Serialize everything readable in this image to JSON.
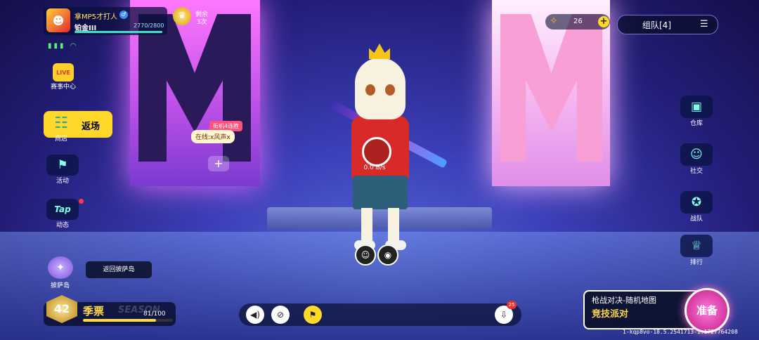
{
  "player": {
    "name": "拿MP5才打人",
    "gender_symbol": "♂",
    "rank": "铂金III",
    "xp": "2770/2800",
    "xp_fraction": 0.989,
    "remaining_label": "剩余",
    "remaining_count": "3次"
  },
  "left_menu": {
    "events": "赛事中心",
    "events_icon_text": "LIVE",
    "shop_action": "返场",
    "shop": "商店",
    "activity": "活动",
    "feed": "动态",
    "feed_icon_text": "Tap"
  },
  "chat": {
    "streak": "街机4连胜",
    "online": "在线:x风声x"
  },
  "island": {
    "label": "披萨岛",
    "return": "返回披萨岛"
  },
  "season": {
    "level": "42",
    "label": "季票",
    "watermark": "SEASON",
    "progress": "81/100",
    "progress_fraction": 0.81
  },
  "character": {
    "speed": "0.0 B/s"
  },
  "bottom_bar": {
    "download_badge": "25"
  },
  "top_right": {
    "currency": "26",
    "team": "组队[4]"
  },
  "right_menu": {
    "warehouse": "仓库",
    "social": "社交",
    "squad": "战队",
    "ranking": "排行"
  },
  "ready_panel": {
    "mode": "枪战对决-随机地图",
    "sub": "竞技派对",
    "ready": "准备"
  },
  "build": "1-kqp8vo-18.5.2541713-1:1727764208",
  "colors": {
    "accent_yellow": "#ffd82a",
    "ready_pink": "#e23aa8",
    "panel_dark": "#0a0f32"
  }
}
